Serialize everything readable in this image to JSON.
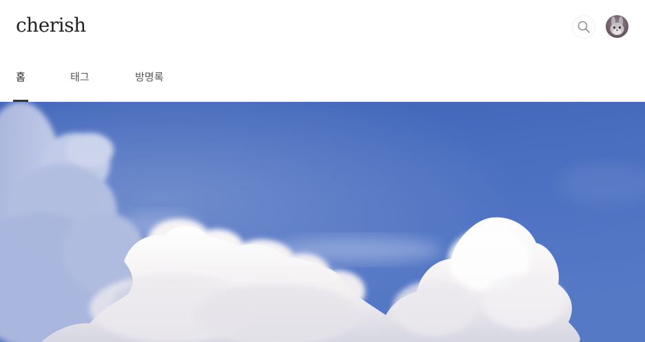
{
  "blog": {
    "title": "cherish"
  },
  "header": {
    "search_icon": "search-icon",
    "avatar_icon": "profile-avatar"
  },
  "nav": {
    "items": [
      {
        "label": "홈",
        "active": true
      },
      {
        "label": "태그",
        "active": false
      },
      {
        "label": "방명록",
        "active": false
      }
    ]
  },
  "hero": {
    "subject": "blue sky with white cumulus clouds"
  },
  "colors": {
    "sky": "#4a6fbe",
    "cloud": "#f4f2f4",
    "text": "#222222",
    "nav_text": "#555555"
  }
}
